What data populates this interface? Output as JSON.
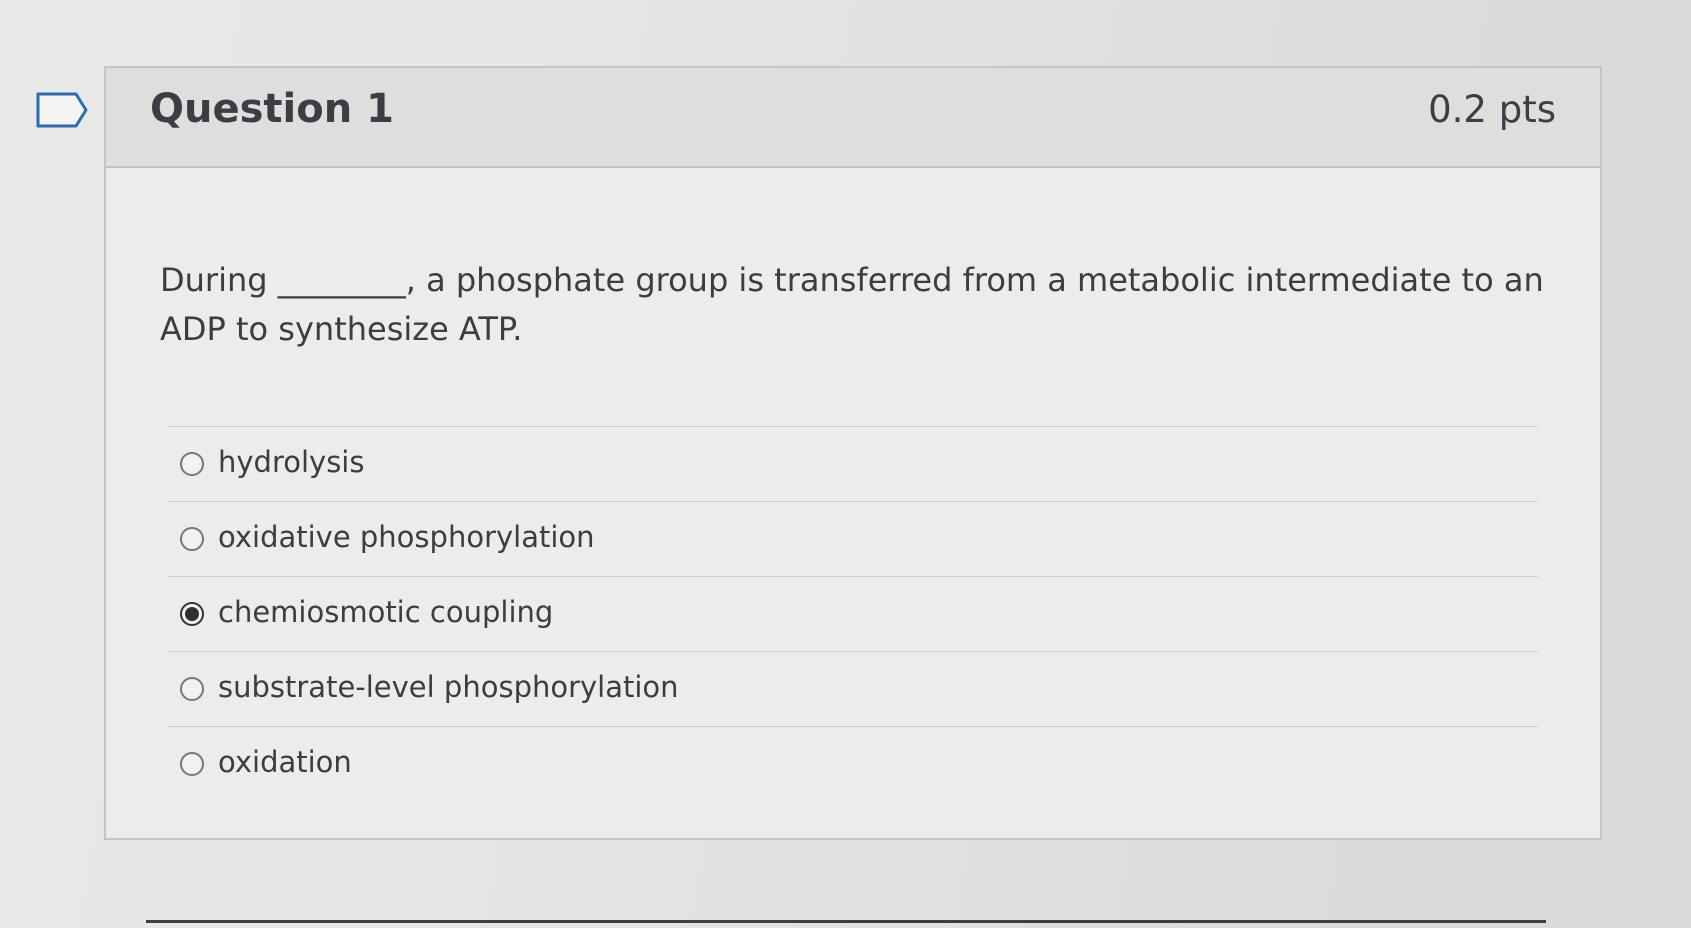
{
  "question": {
    "title": "Question 1",
    "points": "0.2 pts",
    "text": "During ________, a phosphate group is transferred from a metabolic intermediate to an ADP to synthesize ATP.",
    "answers": [
      {
        "label": "hydrolysis",
        "selected": false
      },
      {
        "label": "oxidative phosphorylation",
        "selected": false
      },
      {
        "label": "chemiosmotic coupling",
        "selected": true
      },
      {
        "label": "substrate-level phosphorylation",
        "selected": false
      },
      {
        "label": "oxidation",
        "selected": false
      }
    ]
  },
  "icons": {
    "flag": "flag-question-icon"
  }
}
